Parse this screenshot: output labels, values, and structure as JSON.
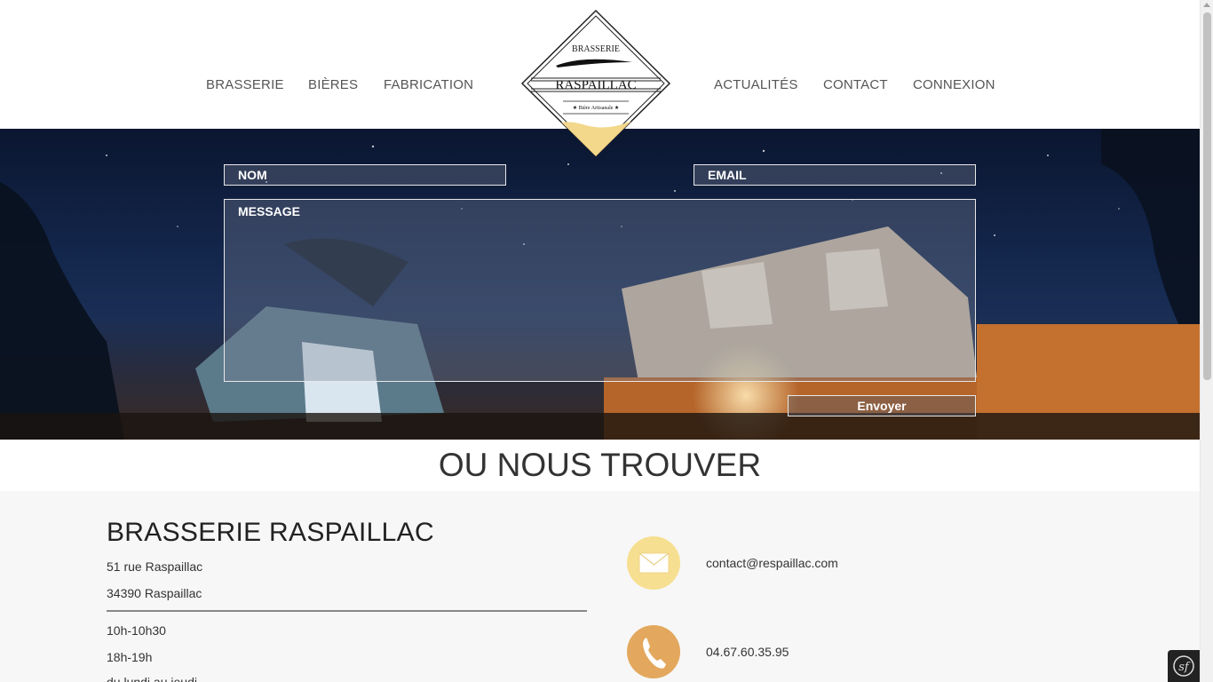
{
  "nav": {
    "left": [
      "BRASSERIE",
      "BIÈRES",
      "FABRICATION"
    ],
    "right": [
      "ACTUALITÉS",
      "CONTACT",
      "CONNEXION"
    ]
  },
  "logo": {
    "top_text": "BRASSERIE",
    "name": "RASPAILLAC",
    "subtitle": "★ Bière Artisanale ★"
  },
  "form": {
    "name_placeholder": "NOM",
    "email_placeholder": "EMAIL",
    "message_placeholder": "MESSAGE",
    "submit_label": "Envoyer"
  },
  "section": {
    "title": "OU NOUS TROUVER"
  },
  "info": {
    "heading": "BRASSERIE RASPAILLAC",
    "address_line1": "51 rue Raspaillac",
    "address_line2": "34390 Raspaillac",
    "hours_line1": "10h-10h30",
    "hours_line2": "18h-19h",
    "days": "du lundi au jeudi",
    "email": "contact@respaillac.com",
    "phone": "04.67.60.35.95"
  },
  "colors": {
    "email_circle": "#f6df90",
    "phone_circle": "#e3a85d",
    "logo_accent": "#f3d78a"
  },
  "icons": {
    "email": "envelope-icon",
    "phone": "phone-icon",
    "toolbar": "symfony-icon"
  }
}
